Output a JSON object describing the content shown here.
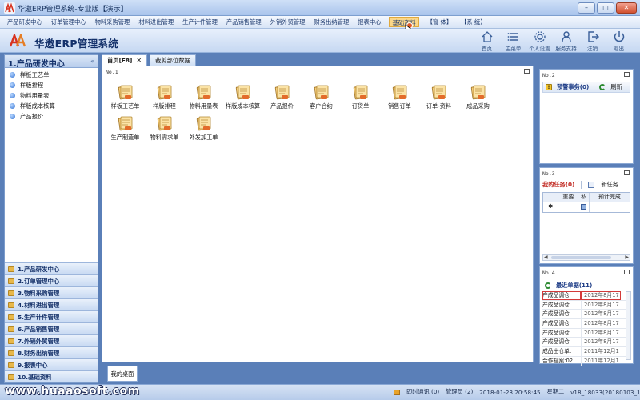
{
  "window": {
    "title": "华遨ERP管理系统-专业版【演示】",
    "min": "–",
    "max": "□",
    "close": "✕"
  },
  "menu": [
    "产品研发中心",
    "订单管理中心",
    "物料采购管理",
    "材料进出管理",
    "生产计件管理",
    "产品销售管理",
    "外销外贸管理",
    "财务出纳管理",
    "报表中心",
    "基础资料",
    "【窗 体】",
    "【系 统】"
  ],
  "menu_active": "基础资料",
  "header": {
    "brand": "华遨ERP管理系统",
    "buttons": [
      {
        "label": "首页",
        "icon": "home-icon"
      },
      {
        "label": "主菜单",
        "icon": "list-icon"
      },
      {
        "label": "个人设置",
        "icon": "gear-icon"
      },
      {
        "label": "服务支持",
        "icon": "support-icon"
      },
      {
        "label": "注销",
        "icon": "logout-icon"
      },
      {
        "label": "退出",
        "icon": "power-icon"
      }
    ]
  },
  "left": {
    "title": "1.产品研发中心",
    "collapse": "«",
    "items": [
      "样板工艺单",
      "样版排程",
      "物料用量表",
      "样版成本核算",
      "产品报价"
    ],
    "sections": [
      "1.产品研发中心",
      "2.订单管理中心",
      "3.物料采购管理",
      "4.材料进出管理",
      "5.生产计件管理",
      "6.产品销售管理",
      "7.外销外贸管理",
      "8.财务出纳管理",
      "9.报表中心",
      "10.基础资料"
    ]
  },
  "tabs": [
    {
      "label": "首页[F8]",
      "close": "✕"
    },
    {
      "label": "裁剪部位数据"
    }
  ],
  "center": {
    "id": "No.1",
    "items": [
      "样板工艺单",
      "样版排程",
      "物料用量表",
      "样版成本核算",
      "产品报价",
      "客户合约",
      "订货单",
      "销售订单",
      "订单-资料",
      "成品采购",
      "生产制造单",
      "物料需求单",
      "外发加工单"
    ],
    "desktop_tab": "我的桌面"
  },
  "panel2": {
    "id": "No.2",
    "warning": "预警事务(0)",
    "refresh": "刷新"
  },
  "panel3": {
    "id": "No.3",
    "my_tasks": "我的任务(0)",
    "new_task": "新任务",
    "columns": [
      "",
      "重要",
      "私",
      "预计完成"
    ],
    "row_marker": "✱"
  },
  "panel4": {
    "id": "No.4",
    "recent": "最近单据(11)",
    "rows": [
      [
        "产成品调仓",
        "2012年8月17"
      ],
      [
        "产成品调仓",
        "2012年8月17"
      ],
      [
        "产成品调仓",
        "2012年8月17"
      ],
      [
        "产成品调仓",
        "2012年8月17"
      ],
      [
        "产成品调仓",
        "2012年8月17"
      ],
      [
        "产成品调仓",
        "2012年8月17"
      ],
      [
        "成品出仓单:",
        "2011年12月1"
      ],
      [
        "合作档案:02",
        "2011年12月1"
      ]
    ]
  },
  "status": {
    "watermark": "www.huaaosoft.com",
    "msg": "即时通讯 (0)",
    "user": "管理员 (2)",
    "datetime": "2018-01-23  20:58:45",
    "weekday": "星期二",
    "version": "v18_18033(20180103_1T)"
  },
  "colors": {
    "accent": "#13306a",
    "menu_active_bg": "#fbd789",
    "red_text": "#c0261e"
  }
}
